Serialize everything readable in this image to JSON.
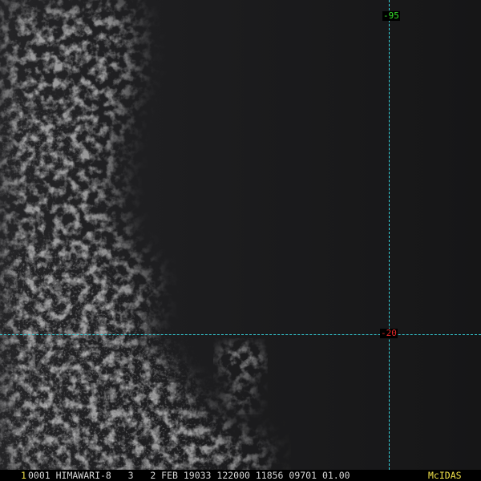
{
  "grid": {
    "longitude_label": "-95",
    "latitude_label": "-20",
    "line_color": "#35d3dd"
  },
  "status_bar": {
    "frame_number": "1",
    "frame_info": "0001 HIMAWARI-8   3   2 FEB 19033 122000 11856 09701 01.00",
    "software_label": "McIDAS"
  },
  "colors": {
    "background": "#1b1b1d",
    "frame_number": "#f2e24a",
    "frame_info": "#d8d8d8",
    "software_label": "#f2e24a",
    "longitude_label": "#35e02a",
    "latitude_label": "#e02828"
  }
}
